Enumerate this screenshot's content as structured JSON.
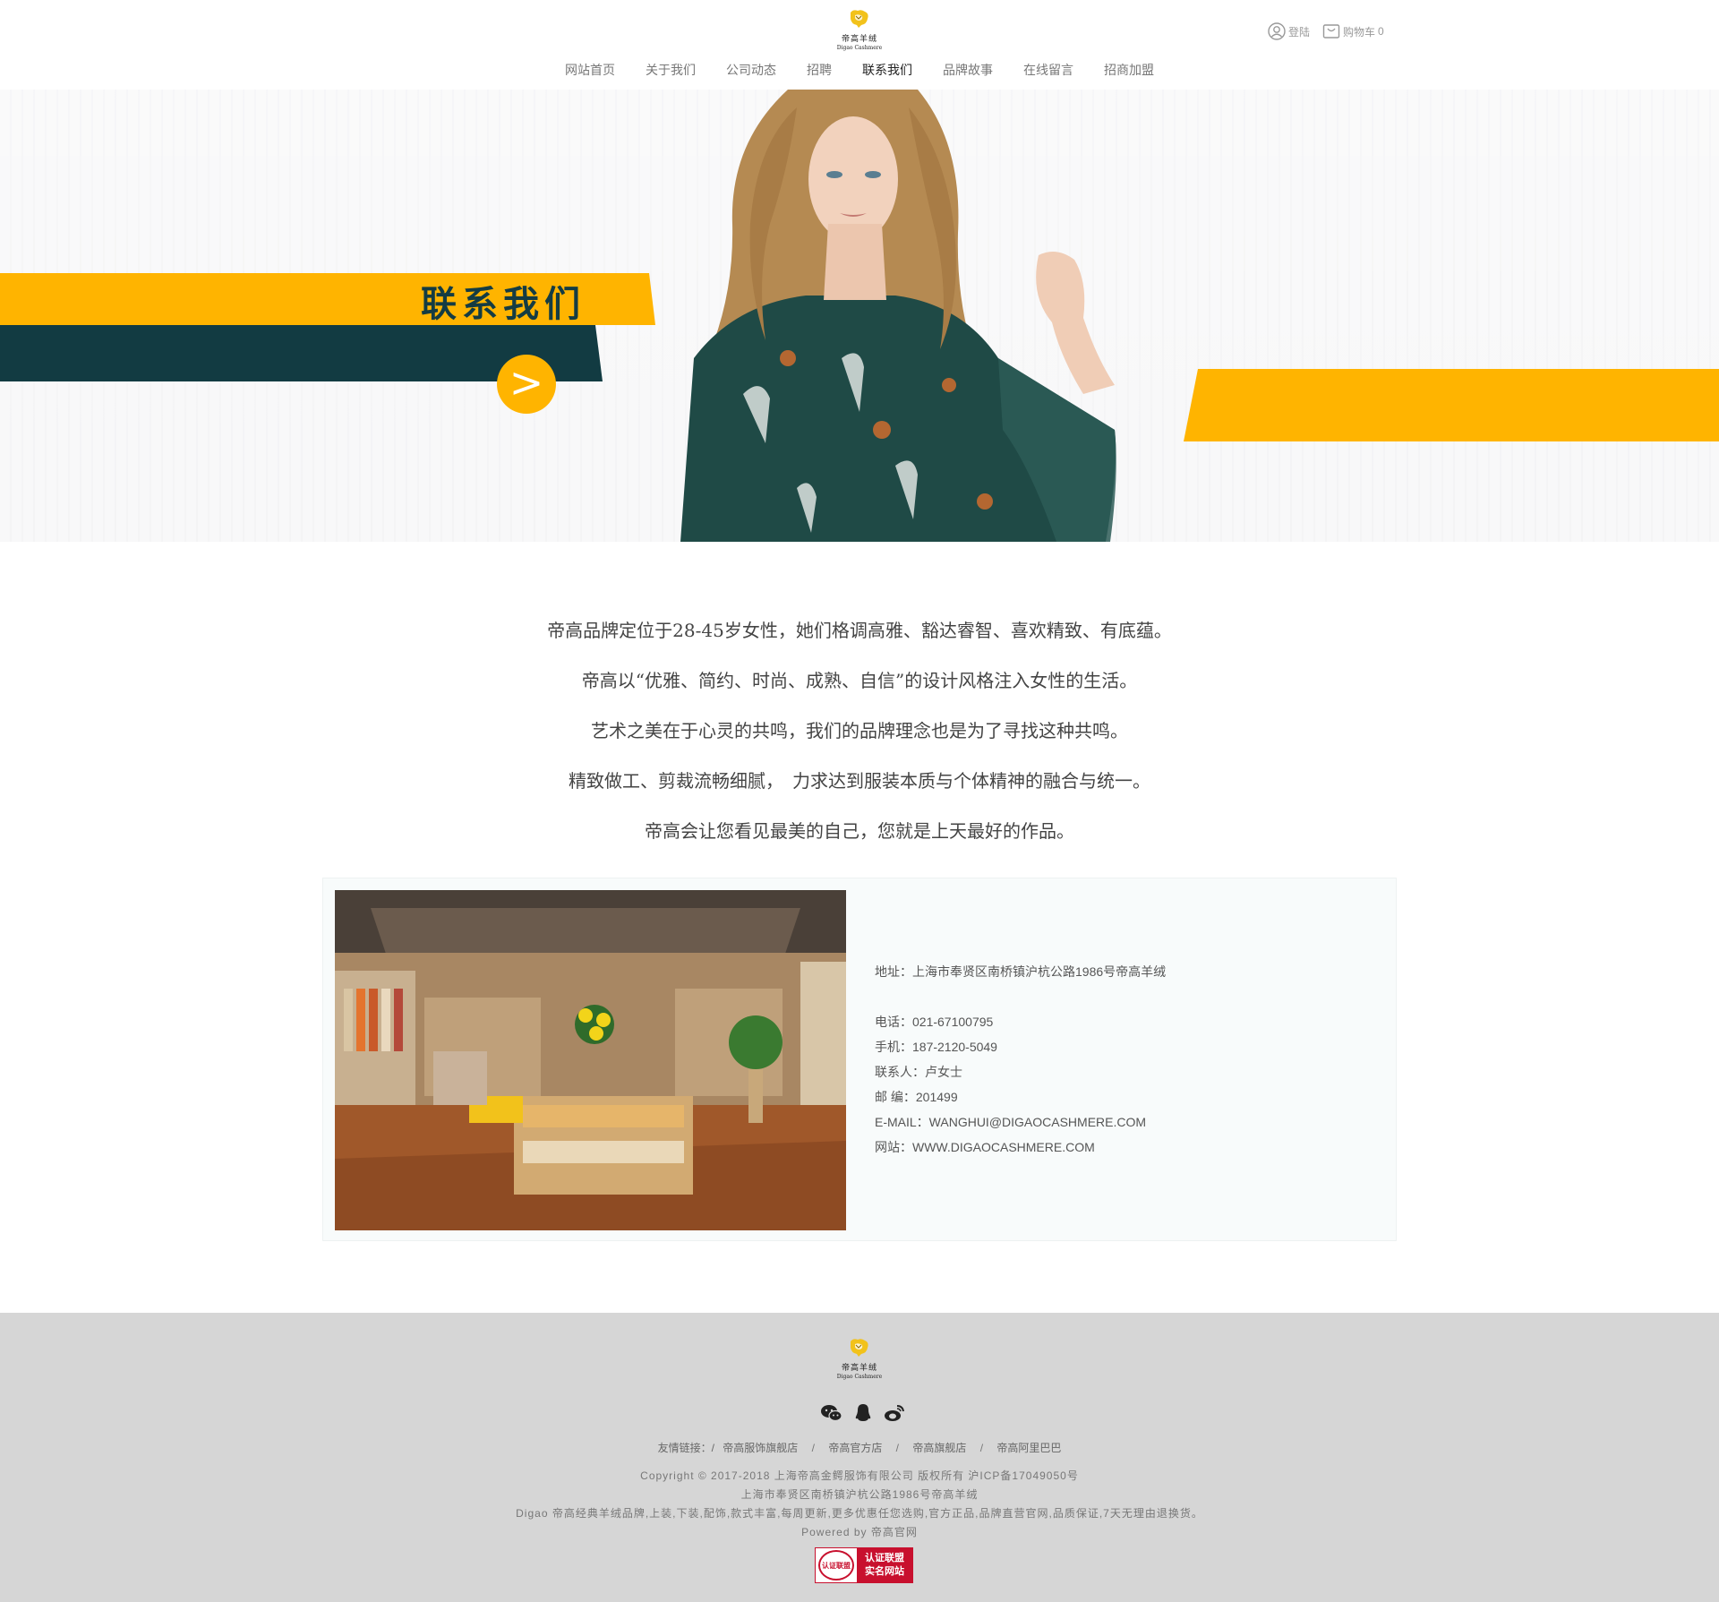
{
  "brand": {
    "name_cn": "帝高羊绒",
    "name_en": "Digao Cashmere",
    "accent_color": "#ffb400",
    "dark_color": "#123b42"
  },
  "header": {
    "login_label": "登陆",
    "cart_label": "购物车",
    "cart_count": "0"
  },
  "nav": {
    "items": [
      {
        "label": "网站首页"
      },
      {
        "label": "关于我们"
      },
      {
        "label": "公司动态"
      },
      {
        "label": "招聘"
      },
      {
        "label": "联系我们",
        "active": true
      },
      {
        "label": "品牌故事"
      },
      {
        "label": "在线留言"
      },
      {
        "label": "招商加盟"
      }
    ]
  },
  "hero": {
    "title": "联系我们",
    "arrow": ">"
  },
  "intro": {
    "lines": [
      "帝高品牌定位于28-45岁女性，她们格调高雅、豁达睿智、喜欢精致、有底蕴。",
      "帝高以“优雅、简约、时尚、成熟、自信”的设计风格注入女性的生活。",
      "艺术之美在于心灵的共鸣，我们的品牌理念也是为了寻找这种共鸣。",
      "精致做工、剪裁流畅细腻，　力求达到服装本质与个体精神的融合与统一。",
      "帝高会让您看见最美的自己，您就是上天最好的作品。"
    ]
  },
  "contact": {
    "address": "地址：上海市奉贤区南桥镇沪杭公路1986号帝高羊绒",
    "phone": "电话：021-67100795",
    "mobile": "手机：187-2120-5049",
    "person": "联系人：卢女士",
    "postcode": "邮  编：201499",
    "email": "E-MAIL：WANGHUI@DIGAOCASHMERE.COM",
    "website": "网站：WWW.DIGAOCASHMERE.COM"
  },
  "footer": {
    "social_icons": [
      "wechat-icon",
      "qq-icon",
      "weibo-icon"
    ],
    "links_label": "友情链接：/",
    "links": [
      "帝高服饰旗舰店",
      "帝高官方店",
      "帝高旗舰店",
      "帝高阿里巴巴"
    ],
    "link_separator": "/",
    "copyright": "Copyright © 2017-2018 上海帝高金鳄服饰有限公司 版权所有 沪ICP备17049050号",
    "address": "上海市奉贤区南桥镇沪杭公路1986号帝高羊绒",
    "description": "Digao 帝高经典羊绒品牌,上装,下装,配饰,款式丰富,每周更新,更多优惠任您选购,官方正品,品牌直营官网,品质保证,7天无理由退换货。",
    "powered_prefix": "Powered by",
    "powered_link": "帝高官网",
    "badge_seal": "认证联盟",
    "badge_line1": "认证联盟",
    "badge_line2": "实名网站"
  }
}
